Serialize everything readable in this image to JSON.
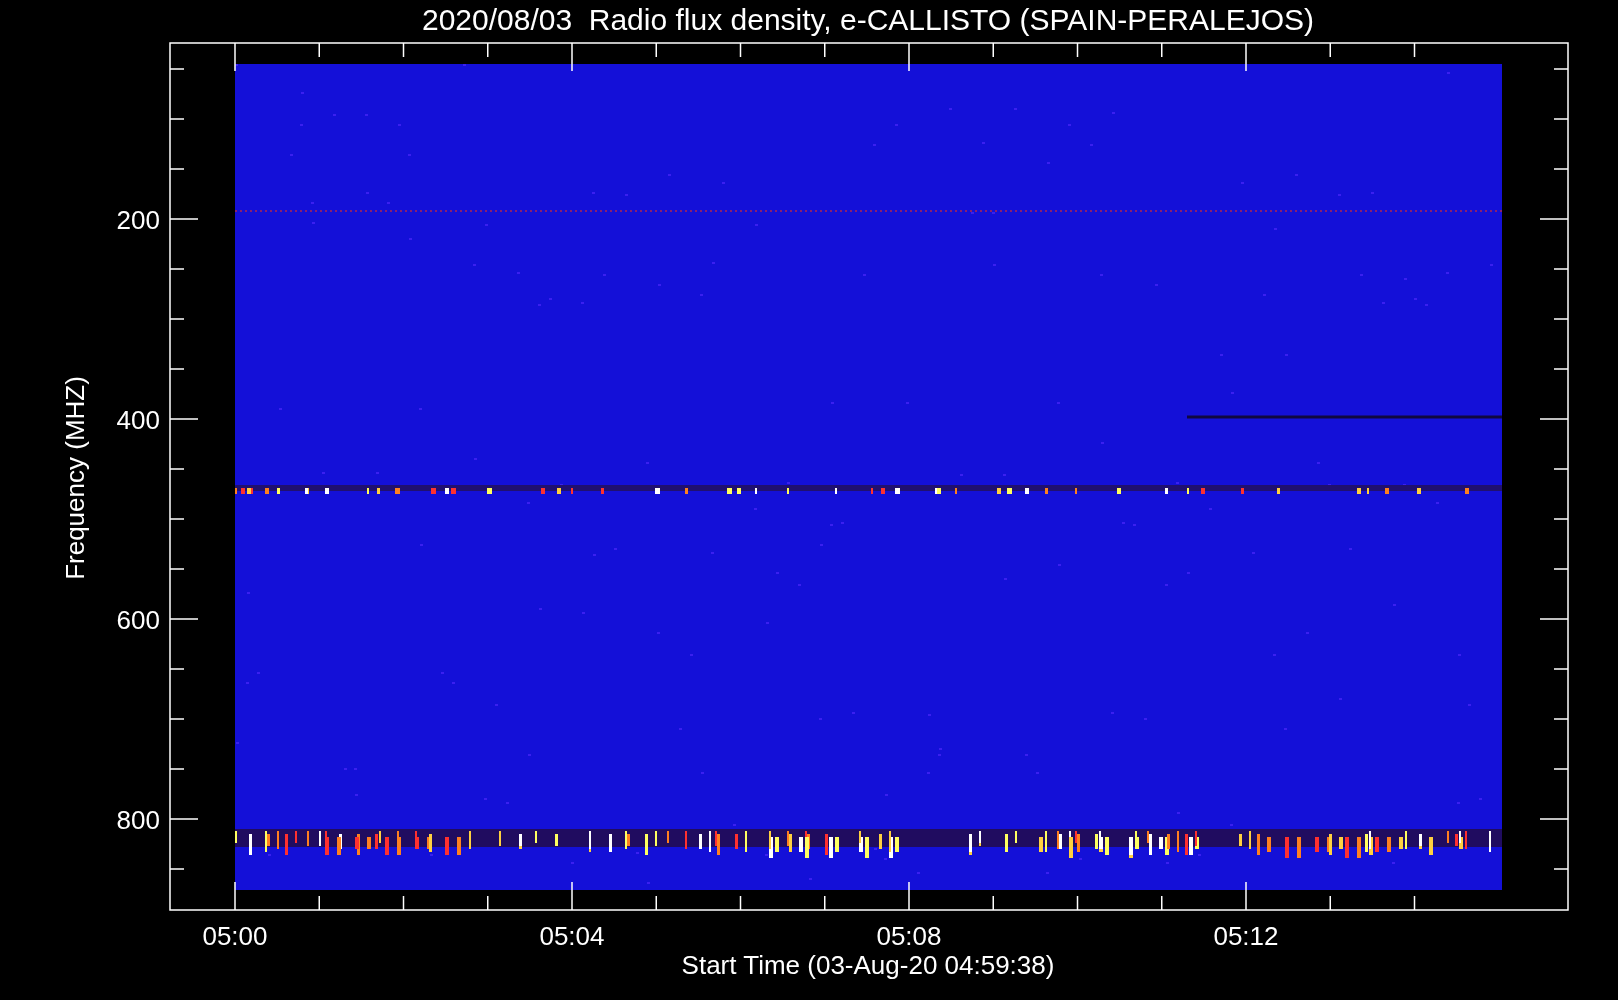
{
  "title": "2020/08/03  Radio flux density, e-CALLISTO (SPAIN-PERALEJOS)",
  "y_axis": {
    "label": "Frequency (MHZ)",
    "tick_labels": [
      "200",
      "400",
      "600",
      "800"
    ]
  },
  "x_axis": {
    "label": "Start Time (03-Aug-20 04:59:38)",
    "tick_labels": [
      "05:00",
      "05:04",
      "05:08",
      "05:12"
    ]
  }
}
